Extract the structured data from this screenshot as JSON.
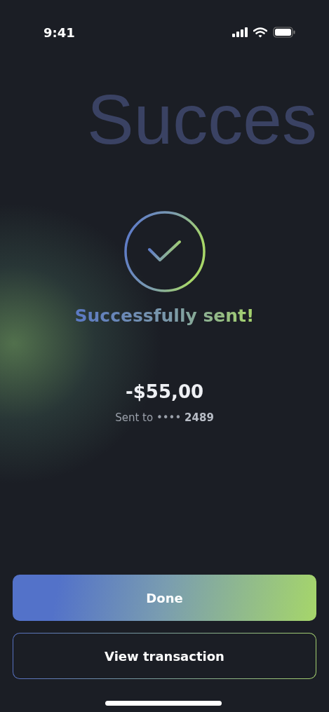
{
  "status_bar": {
    "time": "9:41"
  },
  "background_text": "Succes",
  "title": "Successfully sent!",
  "amount": "-$55,00",
  "recipient": {
    "label": "Sent to",
    "masked": "••••",
    "last_digits": "2489"
  },
  "buttons": [
    {
      "label": "Done",
      "kind": "primary"
    },
    {
      "label": "View transaction",
      "kind": "outline"
    }
  ]
}
